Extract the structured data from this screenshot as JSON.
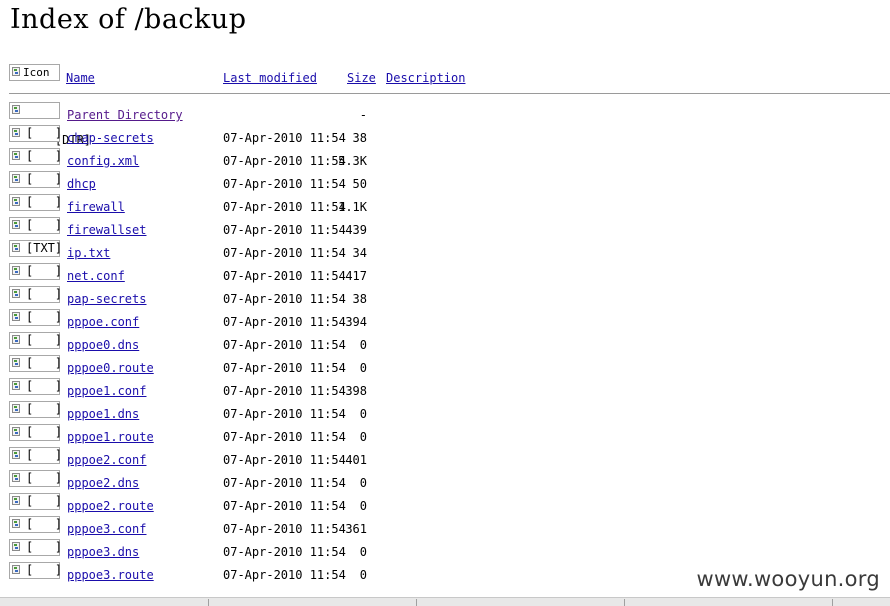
{
  "page": {
    "title": "Index of /backup"
  },
  "header": {
    "icon_alt": "Icon",
    "name_label": "Name",
    "modified_label": "Last modified",
    "size_label": "Size",
    "description_label": "Description"
  },
  "parent": {
    "icon_alt": "[DIR]",
    "name": "Parent Directory",
    "size": "-"
  },
  "files": [
    {
      "icon_alt": "[   ]",
      "name": "chap-secrets",
      "modified": "07-Apr-2010 11:54",
      "size": "38"
    },
    {
      "icon_alt": "[   ]",
      "name": "config.xml",
      "modified": "07-Apr-2010 11:54",
      "size": "5.3K"
    },
    {
      "icon_alt": "[   ]",
      "name": "dhcp",
      "modified": "07-Apr-2010 11:54",
      "size": "50"
    },
    {
      "icon_alt": "[   ]",
      "name": "firewall",
      "modified": "07-Apr-2010 11:54",
      "size": "1.1K"
    },
    {
      "icon_alt": "[   ]",
      "name": "firewallset",
      "modified": "07-Apr-2010 11:54",
      "size": "439"
    },
    {
      "icon_alt": "[TXT]",
      "name": "ip.txt",
      "modified": "07-Apr-2010 11:54",
      "size": "34"
    },
    {
      "icon_alt": "[   ]",
      "name": "net.conf",
      "modified": "07-Apr-2010 11:54",
      "size": "417"
    },
    {
      "icon_alt": "[   ]",
      "name": "pap-secrets",
      "modified": "07-Apr-2010 11:54",
      "size": "38"
    },
    {
      "icon_alt": "[   ]",
      "name": "pppoe.conf",
      "modified": "07-Apr-2010 11:54",
      "size": "394"
    },
    {
      "icon_alt": "[   ]",
      "name": "pppoe0.dns",
      "modified": "07-Apr-2010 11:54",
      "size": "0"
    },
    {
      "icon_alt": "[   ]",
      "name": "pppoe0.route",
      "modified": "07-Apr-2010 11:54",
      "size": "0"
    },
    {
      "icon_alt": "[   ]",
      "name": "pppoe1.conf",
      "modified": "07-Apr-2010 11:54",
      "size": "398"
    },
    {
      "icon_alt": "[   ]",
      "name": "pppoe1.dns",
      "modified": "07-Apr-2010 11:54",
      "size": "0"
    },
    {
      "icon_alt": "[   ]",
      "name": "pppoe1.route",
      "modified": "07-Apr-2010 11:54",
      "size": "0"
    },
    {
      "icon_alt": "[   ]",
      "name": "pppoe2.conf",
      "modified": "07-Apr-2010 11:54",
      "size": "401"
    },
    {
      "icon_alt": "[   ]",
      "name": "pppoe2.dns",
      "modified": "07-Apr-2010 11:54",
      "size": "0"
    },
    {
      "icon_alt": "[   ]",
      "name": "pppoe2.route",
      "modified": "07-Apr-2010 11:54",
      "size": "0"
    },
    {
      "icon_alt": "[   ]",
      "name": "pppoe3.conf",
      "modified": "07-Apr-2010 11:54",
      "size": "361"
    },
    {
      "icon_alt": "[   ]",
      "name": "pppoe3.dns",
      "modified": "07-Apr-2010 11:54",
      "size": "0"
    },
    {
      "icon_alt": "[   ]",
      "name": "pppoe3.route",
      "modified": "07-Apr-2010 11:54",
      "size": "0"
    }
  ],
  "watermark": "www.wooyun.org",
  "colors": {
    "link": "#1a0dab",
    "visited": "#551a8b",
    "rule": "#9a9a9a"
  }
}
